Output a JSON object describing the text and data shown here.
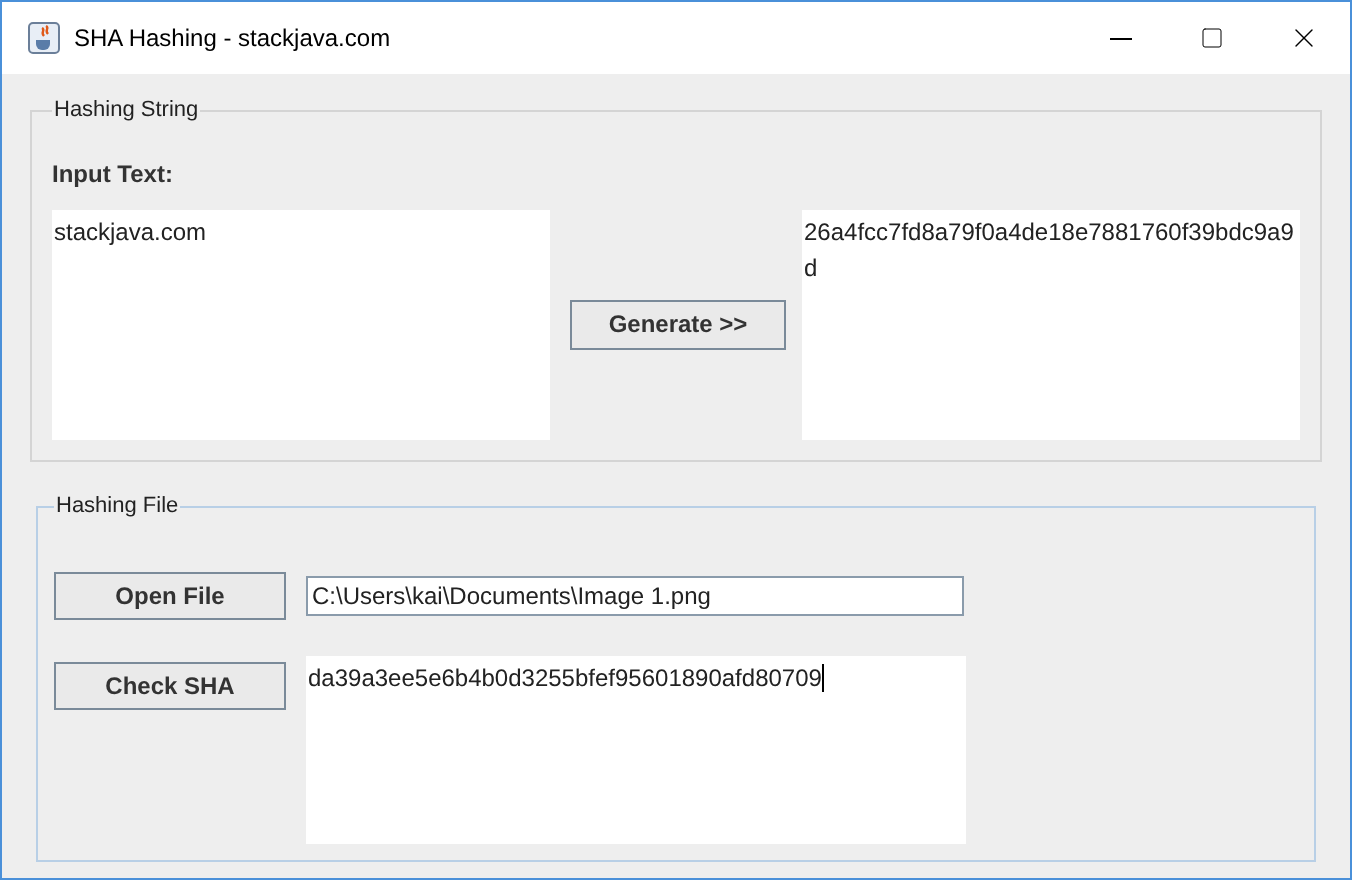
{
  "window": {
    "title": "SHA Hashing - stackjava.com"
  },
  "hashing_string": {
    "legend": "Hashing String",
    "input_label": "Input Text:",
    "input_text": "stackjava.com",
    "button": "Generate >>",
    "output_text": "26a4fcc7fd8a79f0a4de18e7881760f39bdc9a9d"
  },
  "hashing_file": {
    "legend": "Hashing File",
    "open_button": "Open File",
    "file_path": "C:\\Users\\kai\\Documents\\Image 1.png",
    "check_button": "Check SHA",
    "result_text": "da39a3ee5e6b4b0d3255bfef95601890afd80709"
  }
}
